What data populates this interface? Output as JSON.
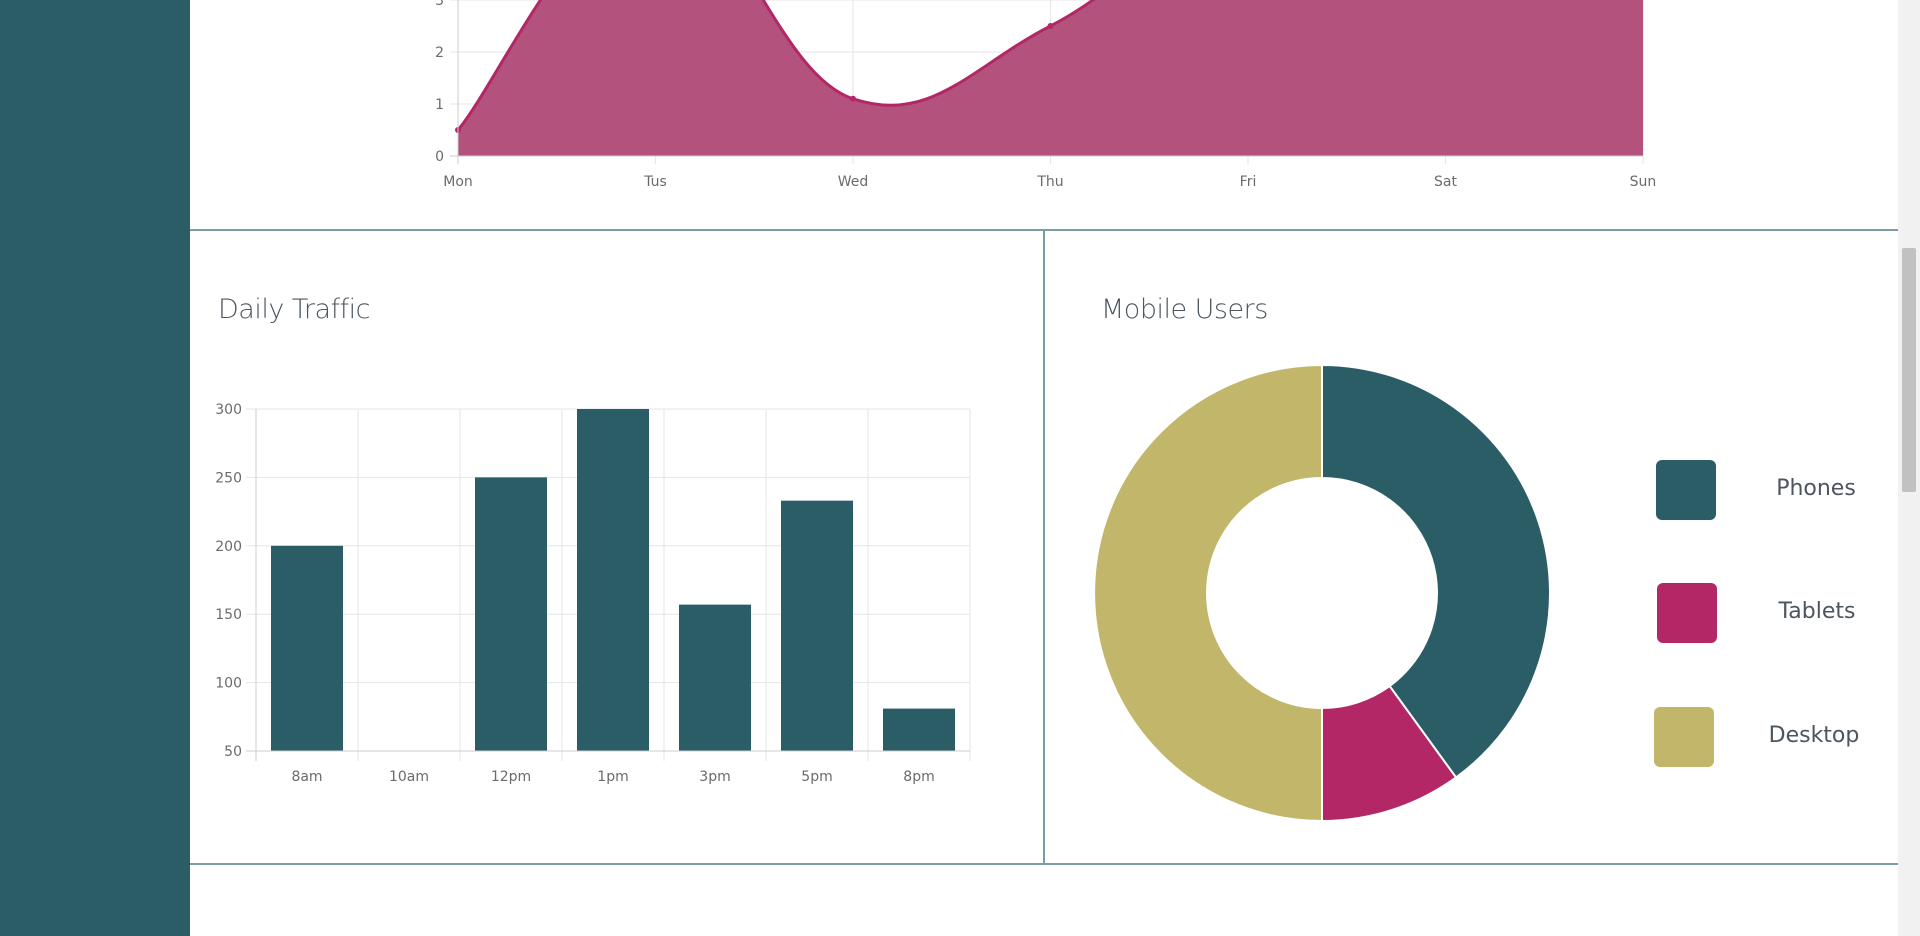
{
  "colors": {
    "sidebar": "#2a5d66",
    "teal": "#2a5d66",
    "magenta": "#b32766",
    "magenta_fill": "#b3537d",
    "olive": "#c1b669",
    "grid": "#e6e6e6",
    "divider": "#7a9da3"
  },
  "icons": {
    "scrollbar": "scrollbar-thumb"
  },
  "weekly_chart": {
    "chart_data": {
      "type": "area",
      "categories": [
        "Mon",
        "Tus",
        "Wed",
        "Thu",
        "Fri",
        "Sat",
        "Sun"
      ],
      "values": [
        0.5,
        5,
        1.1,
        2.5,
        5,
        5,
        5
      ],
      "y_ticks_visible": [
        "0",
        "1",
        "2",
        "3"
      ],
      "ylim": [
        0,
        3
      ],
      "color": "#b32766"
    }
  },
  "daily_traffic": {
    "title": "Daily Traffic",
    "chart_data": {
      "type": "bar",
      "categories": [
        "8am",
        "10am",
        "12pm",
        "1pm",
        "3pm",
        "5pm",
        "8pm"
      ],
      "values": [
        200,
        50,
        250,
        300,
        157,
        233,
        81
      ],
      "y_ticks": [
        "50",
        "100",
        "150",
        "200",
        "250",
        "300"
      ],
      "ylim": [
        50,
        300
      ],
      "color": "#2a5d66",
      "grid": true
    }
  },
  "mobile_users": {
    "title": "Mobile Users",
    "chart_data": {
      "type": "pie",
      "variant": "doughnut",
      "labels": [
        "Phones",
        "Tablets",
        "Desktop"
      ],
      "values": [
        40,
        10,
        50
      ],
      "colors": [
        "#2a5d66",
        "#b32766",
        "#c1b669"
      ]
    },
    "legend": [
      {
        "label": "Phones",
        "color": "#2a5d66"
      },
      {
        "label": "Tablets",
        "color": "#b32766"
      },
      {
        "label": "Desktop",
        "color": "#c1b669"
      }
    ]
  }
}
